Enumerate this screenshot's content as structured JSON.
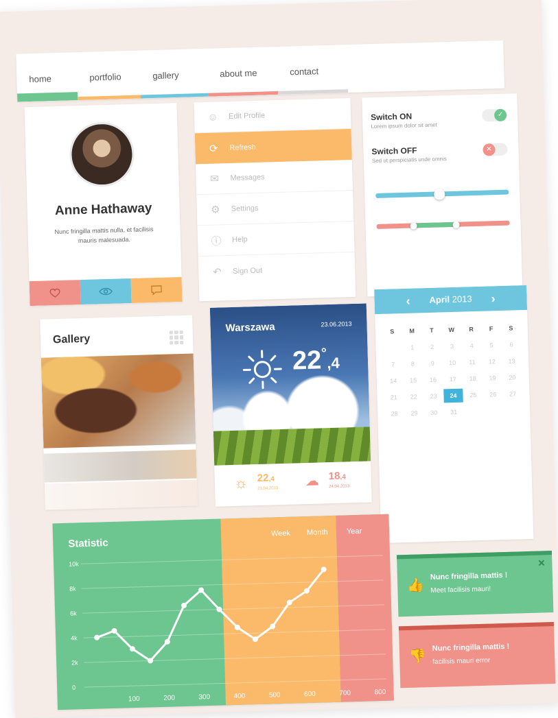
{
  "nav": {
    "items": [
      {
        "label": "home",
        "color": "#6dc58f"
      },
      {
        "label": "portfolio",
        "color": "#fbb96a"
      },
      {
        "label": "gallery",
        "color": "#6ec6de"
      },
      {
        "label": "about me",
        "color": "#f1928a"
      },
      {
        "label": "contact",
        "color": "#d8d8d8"
      }
    ]
  },
  "profile": {
    "name": "Anne Hathaway",
    "bio": "Nunc fringilla mattis nulla, et facilisis mauris malesuada.",
    "actions": [
      {
        "icon": "heart-icon",
        "color": "#f1928a"
      },
      {
        "icon": "eye-icon",
        "color": "#6ec6de"
      },
      {
        "icon": "comment-icon",
        "color": "#fbb96a"
      }
    ]
  },
  "menu": {
    "items": [
      {
        "label": "Edit Profile",
        "icon": "user-icon"
      },
      {
        "label": "Refresh",
        "icon": "refresh-icon",
        "active": true
      },
      {
        "label": "Messages",
        "icon": "envelope-icon"
      },
      {
        "label": "Settings",
        "icon": "gear-icon"
      },
      {
        "label": "Help",
        "icon": "help-icon"
      },
      {
        "label": "Sign Out",
        "icon": "sign-out-icon"
      }
    ]
  },
  "switches": {
    "on": {
      "title": "Switch ON",
      "sub": "Lorem ipsum dolor sit amet",
      "state": true
    },
    "off": {
      "title": "Switch OFF",
      "sub": "Sed ut perspiciatis unde omnis",
      "state": false
    },
    "slider1": {
      "value": 0.48
    },
    "slider2": {
      "low": 0.28,
      "high": 0.6
    }
  },
  "gallery": {
    "title": "Gallery"
  },
  "weather": {
    "city": "Warszawa",
    "date": "23.06.2013",
    "temp_main": "22",
    "temp_deg": "°",
    "temp_dec": ",4",
    "forecast": [
      {
        "temp": "22",
        "dec": ",4",
        "date": "23.04.2013",
        "icon": "sun-icon",
        "color": "#fbb96a"
      },
      {
        "temp": "18",
        "dec": ",4",
        "date": "24.04.2013",
        "icon": "cloud-icon",
        "color": "#f1928a"
      }
    ]
  },
  "calendar": {
    "month": "April",
    "year": "2013",
    "dow": [
      "S",
      "M",
      "T",
      "W",
      "R",
      "F",
      "S"
    ],
    "days": [
      "",
      "1",
      "2",
      "3",
      "4",
      "5",
      "6",
      "7",
      "8",
      "9",
      "10",
      "11",
      "12",
      "13",
      "14",
      "15",
      "16",
      "17",
      "18",
      "19",
      "20",
      "21",
      "22",
      "23",
      "24",
      "25",
      "26",
      "27",
      "28",
      "29",
      "30",
      "31"
    ],
    "today": "24"
  },
  "stats": {
    "title": "Statistic",
    "tabs": {
      "week": "Week",
      "month": "Month",
      "year": "Year"
    }
  },
  "chart_data": {
    "type": "line",
    "title": "Statistic",
    "x": [
      0,
      50,
      100,
      150,
      200,
      250,
      300,
      350,
      400,
      450,
      500,
      550,
      600,
      650,
      700
    ],
    "x_ticks": [
      "100",
      "200",
      "300",
      "400",
      "500",
      "600",
      "700",
      "800"
    ],
    "y_ticks": [
      "0",
      "2k",
      "4k",
      "6k",
      "8k",
      "10k"
    ],
    "series": [
      {
        "values": [
          4000,
          4500,
          3000,
          2000,
          3500,
          6400,
          7600,
          6000,
          4500,
          3500,
          4500,
          6400,
          7300,
          9000,
          null
        ]
      }
    ],
    "ylim": [
      0,
      10000
    ],
    "xlim": [
      0,
      800
    ]
  },
  "notifications": [
    {
      "title": "Nunc fringilla mattis !",
      "message": "Meet facilisis mauri!",
      "icon": "thumbs-up-icon"
    },
    {
      "title": "Nunc fringilla mattis !",
      "message": "facilisis mauri error",
      "icon": "thumbs-down-icon"
    }
  ]
}
